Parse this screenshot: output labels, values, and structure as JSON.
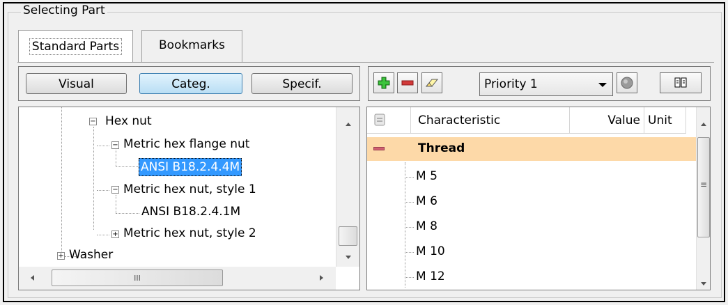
{
  "group": {
    "title": "Selecting Part"
  },
  "tabs": [
    {
      "label": "Standard Parts",
      "active": true
    },
    {
      "label": "Bookmarks",
      "active": false
    }
  ],
  "view_buttons": {
    "visual": "Visual",
    "categ": "Categ.",
    "specif": "Specif."
  },
  "filter_toolbar": {
    "add_icon": "green-plus-icon",
    "remove_icon": "red-minus-icon",
    "clear_icon": "eraser-icon",
    "priority": {
      "selected": "Priority 1"
    },
    "globe_icon": "globe-icon",
    "book_icon": "book-icon"
  },
  "tree": {
    "hex_nut": "Hex nut",
    "metric_hex_flange_nut": "Metric hex flange nut",
    "ansi_4m": "ANSI B18.2.4.4M",
    "metric_hex_nut_style1": "Metric hex nut, style 1",
    "ansi_1m": "ANSI B18.2.4.1M",
    "metric_hex_nut_style2": "Metric hex nut, style 2",
    "washer": "Washer",
    "selected_item": "ANSI B18.2.4.4M"
  },
  "grid": {
    "columns": {
      "characteristic": "Characteristic",
      "value": "Value",
      "unit": "Unit"
    },
    "group_row": "Thread",
    "rows": [
      "M 5",
      "M 6",
      "M 8",
      "M 10",
      "M 12"
    ],
    "highlight_color": "#fdd9a8"
  },
  "scroll_glyphs": {
    "thumb_grip": "≡",
    "h_thumb_grip": "III"
  }
}
